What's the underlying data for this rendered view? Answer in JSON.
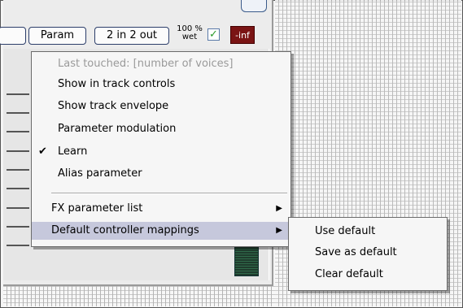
{
  "toolbar": {
    "param_label": "Param",
    "io_label": "2 in 2 out",
    "wet_line1": "100 %",
    "wet_line2": "wet",
    "checkbox_mark": "✓",
    "output_level": "-inf"
  },
  "menu": {
    "header": "Last touched: [number of voices]",
    "items": [
      {
        "label": "Show in track controls",
        "checked": false
      },
      {
        "label": "Show track envelope",
        "checked": false
      },
      {
        "label": "Parameter modulation",
        "checked": false
      },
      {
        "label": "Learn",
        "checked": true,
        "check_mark": "✔"
      },
      {
        "label": "Alias parameter",
        "checked": false
      }
    ],
    "fx_parameter_list": "FX parameter list",
    "default_controller_mappings": "Default controller mappings",
    "arrow": "▶"
  },
  "submenu": {
    "items": [
      "Use default",
      "Save as default",
      "Clear default"
    ]
  }
}
